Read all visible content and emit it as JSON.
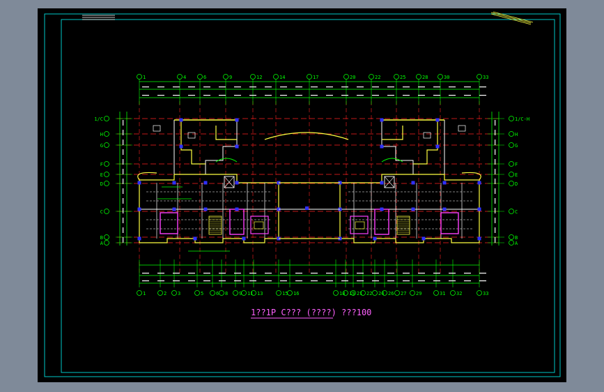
{
  "title": "1??1P C??? (????) ???100",
  "top_axes": [
    "1",
    "4",
    "6",
    "9",
    "12",
    "14",
    "17",
    "20",
    "22",
    "25",
    "28",
    "30",
    "33"
  ],
  "bottom_axes": [
    "1",
    "2",
    "3",
    "5",
    "6",
    "8",
    "9",
    "11",
    "13",
    "15",
    "16",
    "18",
    "19",
    "21",
    "22",
    "24",
    "26",
    "27",
    "29",
    "31",
    "32",
    "33"
  ],
  "left_axes": [
    "1/C",
    "H",
    "G",
    "F",
    "E",
    "D",
    "C",
    "B",
    "A"
  ],
  "right_axes": [
    "1/C-H",
    "H",
    "G",
    "F",
    "E",
    "D",
    "C",
    "B",
    "A"
  ],
  "colors": {
    "sheet": "#000000",
    "outer_frame": "#00c8c8",
    "grid_line": "#ff2020",
    "axis_line": "#00ff00",
    "wall": "#ffff40",
    "highlight": "#ff40ff",
    "column": "#3030ff",
    "outline": "#ffffff"
  }
}
